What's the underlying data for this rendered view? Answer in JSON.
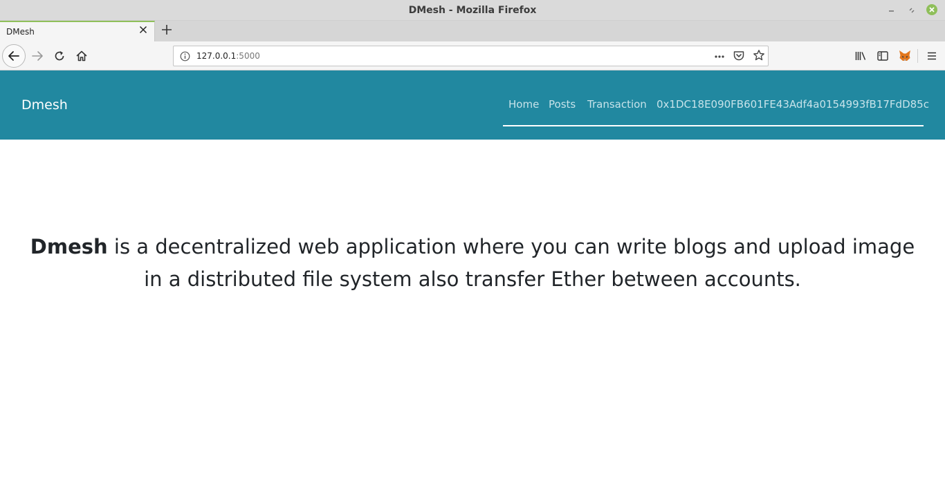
{
  "window": {
    "title": "DMesh - Mozilla Firefox"
  },
  "tabs": [
    {
      "label": "DMesh"
    }
  ],
  "address_bar": {
    "host": "127.0.0.1",
    "port": ":5000"
  },
  "site": {
    "brand": "Dmesh",
    "nav": {
      "home": "Home",
      "posts": "Posts",
      "transaction": "Transaction",
      "account": "0x1DC18E090FB601FE43Adf4a0154993fB17FdD85c"
    },
    "hero": {
      "brand": "Dmesh",
      "text": " is a decentralized web application where you can write blogs and upload image in a distributed file system also transfer Ether between accounts."
    }
  },
  "colors": {
    "site_navbar": "#2188a0",
    "nav_link": "#c7e3ea",
    "tab_accent": "#8fbf5a"
  },
  "icons": [
    "back-icon",
    "forward-icon",
    "reload-icon",
    "home-icon",
    "info-icon",
    "page-actions-icon",
    "pocket-icon",
    "bookmark-star-icon",
    "library-icon",
    "sidebar-icon",
    "metamask-fox-icon",
    "hamburger-menu-icon",
    "close-icon",
    "new-tab-icon",
    "minimize-icon",
    "maximize-icon",
    "window-close-icon"
  ]
}
